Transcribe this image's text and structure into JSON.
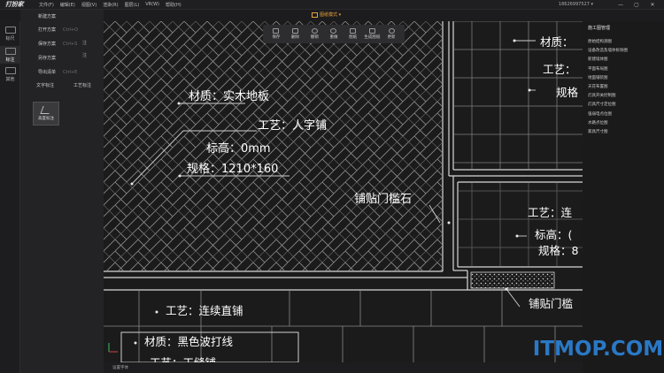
{
  "app": {
    "logo": "打扮家",
    "menu": [
      "文件(F)",
      "编辑(E)",
      "视图(V)",
      "渲染(R)",
      "图层(L)",
      "VR(W)",
      "帮助(H)"
    ],
    "account": "18626997527 ▾",
    "window_controls": [
      "—",
      "▢",
      "✕"
    ]
  },
  "mode": {
    "label": "图纸模式 ▾"
  },
  "left_toolbar": [
    {
      "label": "标尺",
      "icon": "ruler-icon"
    },
    {
      "label": "标注",
      "icon": "annotate-icon",
      "active": true
    },
    {
      "label": "其他",
      "icon": "more-icon"
    }
  ],
  "panel": {
    "header": "新建方案",
    "rows": [
      {
        "label": "打开方案",
        "shortcut": "Ctrl+O"
      },
      {
        "label": "保存方案",
        "shortcut": "Ctrl+S"
      },
      {
        "label": "另存方案",
        "shortcut": ""
      },
      {
        "label": "导出清单",
        "shortcut": "Ctrl+E"
      }
    ],
    "side_labels": [
      "注",
      "注"
    ],
    "buttons": [
      "文字标注",
      "工艺标注"
    ],
    "tile_label": "高度标注"
  },
  "drawbar": [
    {
      "label": "保存",
      "icon": "save-icon"
    },
    {
      "label": "删除",
      "icon": "delete-icon"
    },
    {
      "label": "撤销",
      "icon": "undo-icon"
    },
    {
      "label": "重做",
      "icon": "redo-icon"
    },
    {
      "label": "图纸",
      "icon": "drawing-icon"
    },
    {
      "label": "生成图纸",
      "icon": "generate-icon"
    },
    {
      "label": "更新",
      "icon": "refresh-icon"
    }
  ],
  "right_panel": {
    "title": "施工图管理",
    "items": [
      "原始结构测图",
      "设备改造及墙体拆除图",
      "新建墙体图",
      "平面布局图",
      "地面铺装图",
      "天花布置图",
      "灯具开关控制图",
      "灯具尺寸定位图",
      "强弱电点位图",
      "水路点位图",
      "家具尺寸图"
    ]
  },
  "annotations": {
    "a1": "材质：实木地板",
    "a2": "工艺：人字铺",
    "a3": "标高：0mm",
    "a4": "规格：1210*160",
    "a5": "铺贴门槛石",
    "a6": "材质：",
    "a7": "工艺：",
    "a8": "规格",
    "a9": "工艺：连",
    "a10": "标高：(",
    "a11": "规格：8",
    "a12": "铺贴门槛",
    "a13": "工艺：连续直铺",
    "a14": "材质：黑色波打线",
    "a15": "工艺：工缝铺"
  },
  "status": {
    "text": "设置字体"
  },
  "watermark": "ITMOP.COM"
}
